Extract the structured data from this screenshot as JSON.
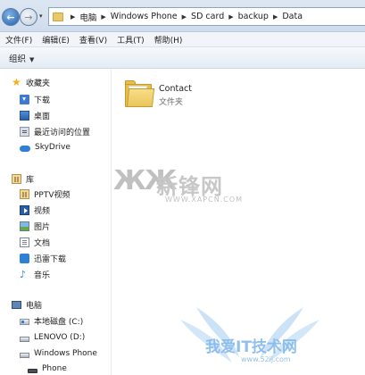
{
  "nav_buttons": {
    "back_glyph": "←",
    "forward_glyph": "→",
    "history_glyph": "▾"
  },
  "address_bar": {
    "root_glyph": "▶",
    "separator_glyph": "▶",
    "breadcrumbs": [
      "电脑",
      "Windows Phone",
      "SD card",
      "backup",
      "Data"
    ]
  },
  "menu_bar": {
    "items": [
      "文件(F)",
      "编辑(E)",
      "查看(V)",
      "工具(T)",
      "帮助(H)"
    ]
  },
  "toolbar": {
    "organize_label": "组织",
    "organize_caret": "▼"
  },
  "nav_pane": {
    "favorites": {
      "header": "收藏夹",
      "items": [
        "下载",
        "桌面",
        "最近访问的位置",
        "SkyDrive"
      ]
    },
    "libraries": {
      "header": "库",
      "items": [
        "PPTV视频",
        "视频",
        "图片",
        "文档",
        "迅雷下载",
        "音乐"
      ]
    },
    "computer": {
      "header": "电脑",
      "items": [
        "本地磁盘 (C:)",
        "LENOVO (D:)",
        "Windows Phone",
        "Phone"
      ]
    }
  },
  "content": {
    "items": [
      {
        "name": "Contact",
        "type": "文件夹"
      }
    ]
  },
  "icons": {
    "favorites": "star-icon",
    "download": "download-icon",
    "desktop": "desktop-icon",
    "recent": "recent-places-icon",
    "skydrive": "cloud-icon",
    "library": "library-icon",
    "folder": "folder-icon"
  },
  "watermarks": {
    "xapcn_logo": "ЖЖ",
    "xapcn_title": "新锋网",
    "xapcn_url": "WWW.XAPCN.COM",
    "ij_title": "我爱IT技术网",
    "ij_url": "www.52ij.com"
  },
  "colors": {
    "accent_blue": "#2460a8",
    "folder_yellow": "#e7bf4f",
    "toolbar_gradient_top": "#f6f9fc",
    "toolbar_gradient_bottom": "#e3ebf4"
  }
}
